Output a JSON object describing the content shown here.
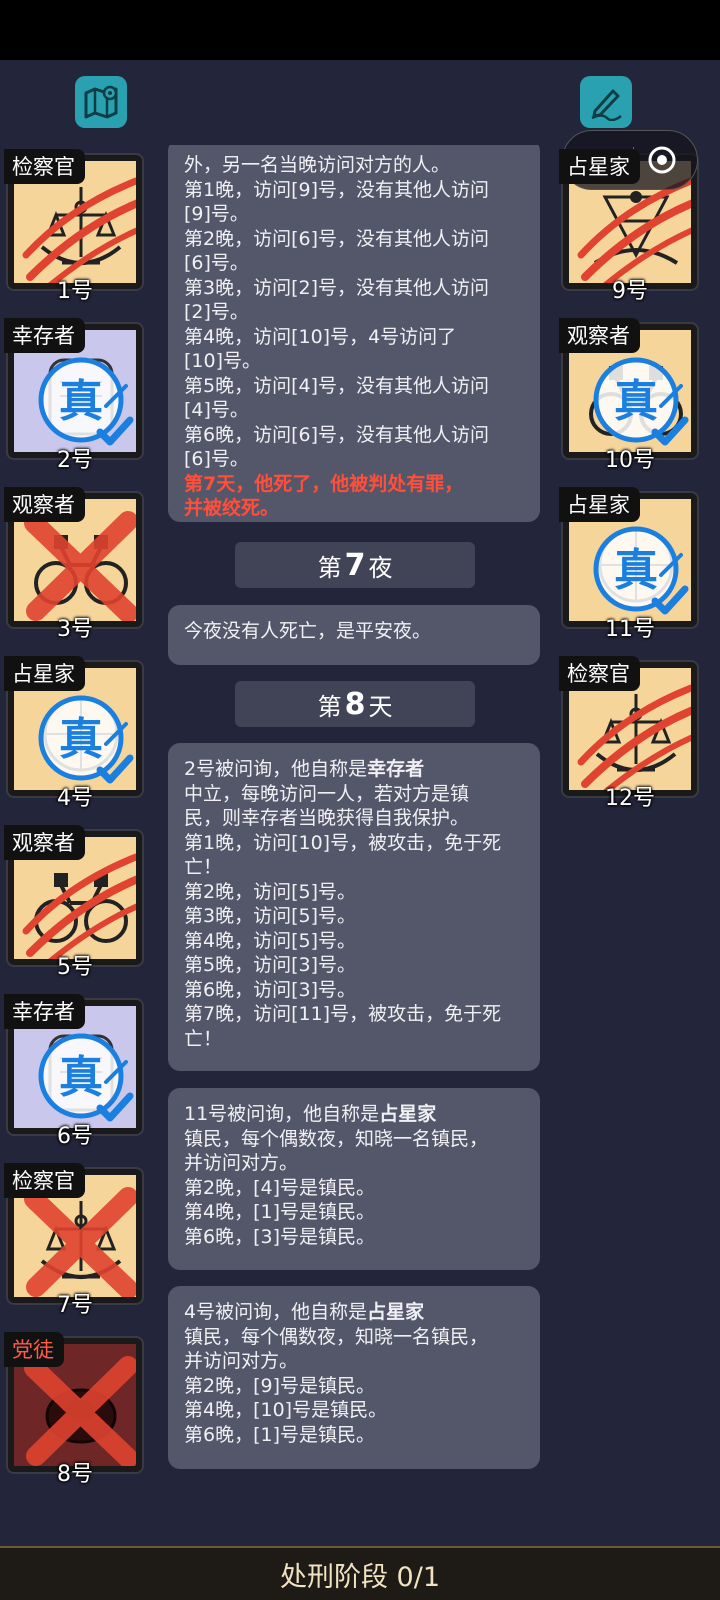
{
  "players_left": [
    {
      "role": "检察官",
      "number": "1号",
      "icon": "prosecutor-scales-icon",
      "state": "clawed"
    },
    {
      "role": "幸存者",
      "number": "2号",
      "icon": "survivor-icon",
      "state": "verified",
      "verified_label": "真"
    },
    {
      "role": "观察者",
      "number": "3号",
      "icon": "binoculars-icon",
      "state": "crossed"
    },
    {
      "role": "占星家",
      "number": "4号",
      "icon": "astrologer-icon",
      "state": "verified",
      "verified_label": "真"
    },
    {
      "role": "观察者",
      "number": "5号",
      "icon": "binoculars-icon",
      "state": "clawed"
    },
    {
      "role": "幸存者",
      "number": "6号",
      "icon": "survivor-icon",
      "state": "verified",
      "verified_label": "真"
    },
    {
      "role": "检察官",
      "number": "7号",
      "icon": "prosecutor-scales-icon",
      "state": "crossed"
    },
    {
      "role": "党徒",
      "number": "8号",
      "icon": "cultist-icon",
      "state": "crossed"
    }
  ],
  "players_right": [
    {
      "role": "占星家",
      "number": "9号",
      "icon": "sextant-icon",
      "state": "clawed"
    },
    {
      "role": "观察者",
      "number": "10号",
      "icon": "binoculars-icon",
      "state": "verified",
      "verified_label": "真"
    },
    {
      "role": "占星家",
      "number": "11号",
      "icon": "astrologer-icon",
      "state": "verified",
      "verified_label": "真"
    },
    {
      "role": "检察官",
      "number": "12号",
      "icon": "prosecutor-scales-icon",
      "state": "clawed"
    }
  ],
  "top_icons": {
    "left": "map-pin-icon",
    "right": "edit-pen-icon",
    "capsule_left": "more-dots-icon",
    "capsule_right": "target-close-icon"
  },
  "chat": {
    "bubble1_lines": [
      "外，另一名当晚访问对方的人。",
      "第1晚，访问[9]号，没有其他人访问",
      "[9]号。",
      "第2晚，访问[6]号，没有其他人访问",
      "[6]号。",
      "第3晚，访问[2]号，没有其他人访问",
      "[2]号。",
      "第4晚，访问[10]号，4号访问了",
      "[10]号。",
      "第5晚，访问[4]号，没有其他人访问",
      "[4]号。",
      "第6晚，访问[6]号，没有其他人访问",
      "[6]号。"
    ],
    "bubble1_red": [
      "第7天，他死了，他被判处有罪，",
      "并被绞死。"
    ],
    "divider_night": {
      "pre": "第",
      "num": "7",
      "post": "夜"
    },
    "bubble2": "今夜没有人死亡，是平安夜。",
    "divider_day": {
      "pre": "第",
      "num": "8",
      "post": "天"
    },
    "bubble3_title_pre": "2号被问询，他自称是",
    "bubble3_title_role": "幸存者",
    "bubble3_lines": [
      "中立，每晚访问一人，若对方是镇",
      "民，则幸存者当晚获得自我保护。",
      "第1晚，访问[10]号，被攻击，免于死",
      "亡！",
      "第2晚，访问[5]号。",
      "第3晚，访问[5]号。",
      "第4晚，访问[5]号。",
      "第5晚，访问[3]号。",
      "第6晚，访问[3]号。",
      "第7晚，访问[11]号，被攻击，免于死",
      "亡！"
    ],
    "bubble4_title_pre": "11号被问询，他自称是",
    "bubble4_title_role": "占星家",
    "bubble4_lines": [
      "镇民，每个偶数夜，知晓一名镇民，",
      "并访问对方。",
      "第2晚，[4]号是镇民。",
      "第4晚，[1]号是镇民。",
      "第6晚，[3]号是镇民。"
    ],
    "bubble5_title_pre": "4号被问询，他自称是",
    "bubble5_title_role": "占星家",
    "bubble5_lines": [
      "镇民，每个偶数夜，知晓一名镇民，",
      "并访问对方。",
      "第2晚，[9]号是镇民。",
      "第4晚，[10]号是镇民。",
      "第6晚，[1]号是镇民。"
    ]
  },
  "bottom_bar": {
    "label": "处刑阶段 0/1"
  },
  "colors": {
    "background": "#23253a",
    "card_town": "#f6d59b",
    "card_survivor": "#c9c8ec",
    "card_cultist": "#6e2626",
    "verify_blue": "#1b7fe0",
    "claw_red": "#e0432f",
    "alert_red": "#ff4f3b",
    "bubble": "#545769"
  }
}
